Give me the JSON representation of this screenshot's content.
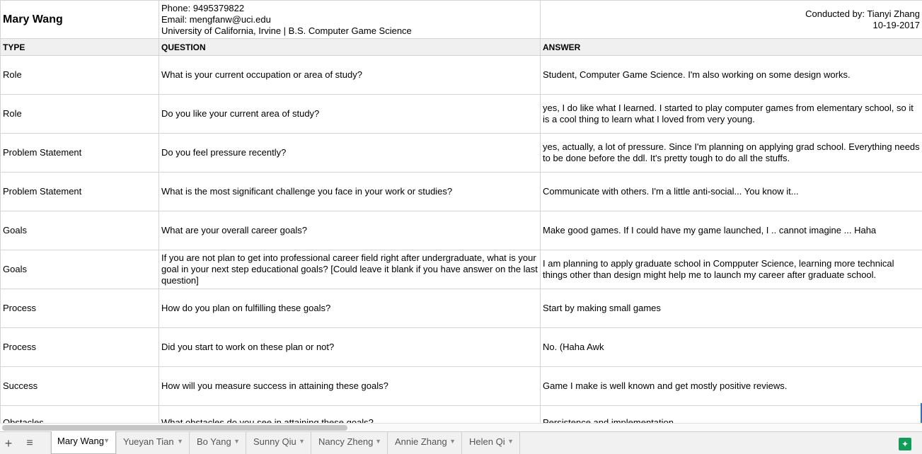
{
  "interviewee": {
    "name": "Mary Wang",
    "phone": "Phone: 9495379822",
    "email": "Email: mengfanw@uci.edu",
    "school": "University of California, Irvine | B.S. Computer Game Science",
    "conducted_by": "Conducted by: Tianyi Zhang",
    "date": "10-19-2017"
  },
  "columns": [
    "TYPE",
    "QUESTION",
    "ANSWER"
  ],
  "rows": [
    {
      "type": "Role",
      "question": "What is your current occupation or area of study?",
      "answer": "Student, Computer Game Science. I'm also working on some design works."
    },
    {
      "type": "Role",
      "question": "Do you like your current area of study?",
      "answer": "yes, I do like what I learned. I started to play computer games from elementary school, so it is a cool thing to learn what I loved from very young."
    },
    {
      "type": "Problem Statement",
      "question": "Do you feel pressure recently?",
      "answer": "yes, actually, a lot of pressure. Since I'm planning on applying grad school. Everything needs to be done before the ddl. It's pretty tough to do all the stuffs."
    },
    {
      "type": "Problem Statement",
      "question": "What is the most significant challenge you face in your work or studies?",
      "answer": "Communicate with others. I'm a little anti-social... You know it..."
    },
    {
      "type": "Goals",
      "question": "What are your overall career goals?",
      "answer": "Make good games. If I could have my game launched, I .. cannot imagine ... Haha"
    },
    {
      "type": "Goals",
      "question": "If you are not plan to get into professional career field right after undergraduate, what is your goal in your next step educational goals? [Could leave it blank if you have answer on the last question]",
      "answer": "I am planning to apply graduate school in Compputer Science, learning more technical things other than design might help me to launch my career after graduate school."
    },
    {
      "type": "Process",
      "question": "How do you plan on fulfilling these goals?",
      "answer": "Start by making small games"
    },
    {
      "type": "Process",
      "question": "Did you start to work on these plan or not?",
      "answer": "No. (Haha Awk"
    },
    {
      "type": "Success",
      "question": "How will you measure success in attaining these goals?",
      "answer": "Game I make is well known and get mostly positive reviews."
    },
    {
      "type": "Obstacles",
      "question": "What obstacles do you see in attaining these goals?",
      "answer": "Persistence and implementation"
    }
  ],
  "tabs": [
    {
      "label": "Mary Wang",
      "active": true
    },
    {
      "label": "Yueyan Tian",
      "active": false
    },
    {
      "label": "Bo Yang",
      "active": false
    },
    {
      "label": "Sunny Qiu",
      "active": false
    },
    {
      "label": "Nancy Zheng",
      "active": false
    },
    {
      "label": "Annie Zhang",
      "active": false
    },
    {
      "label": "Helen Qi",
      "active": false
    }
  ],
  "toolbar": {
    "add_icon": "plus-icon",
    "all_sheets_icon": "menu-list-icon",
    "explore_icon": "explore-icon",
    "add_glyph": "+",
    "all_sheets_glyph": "≡",
    "explore_glyph": "✦"
  },
  "colors": {
    "header_bg": "#f0f0f0",
    "explore_green": "#0f9d58",
    "selection_blue": "#2f6fd6"
  }
}
